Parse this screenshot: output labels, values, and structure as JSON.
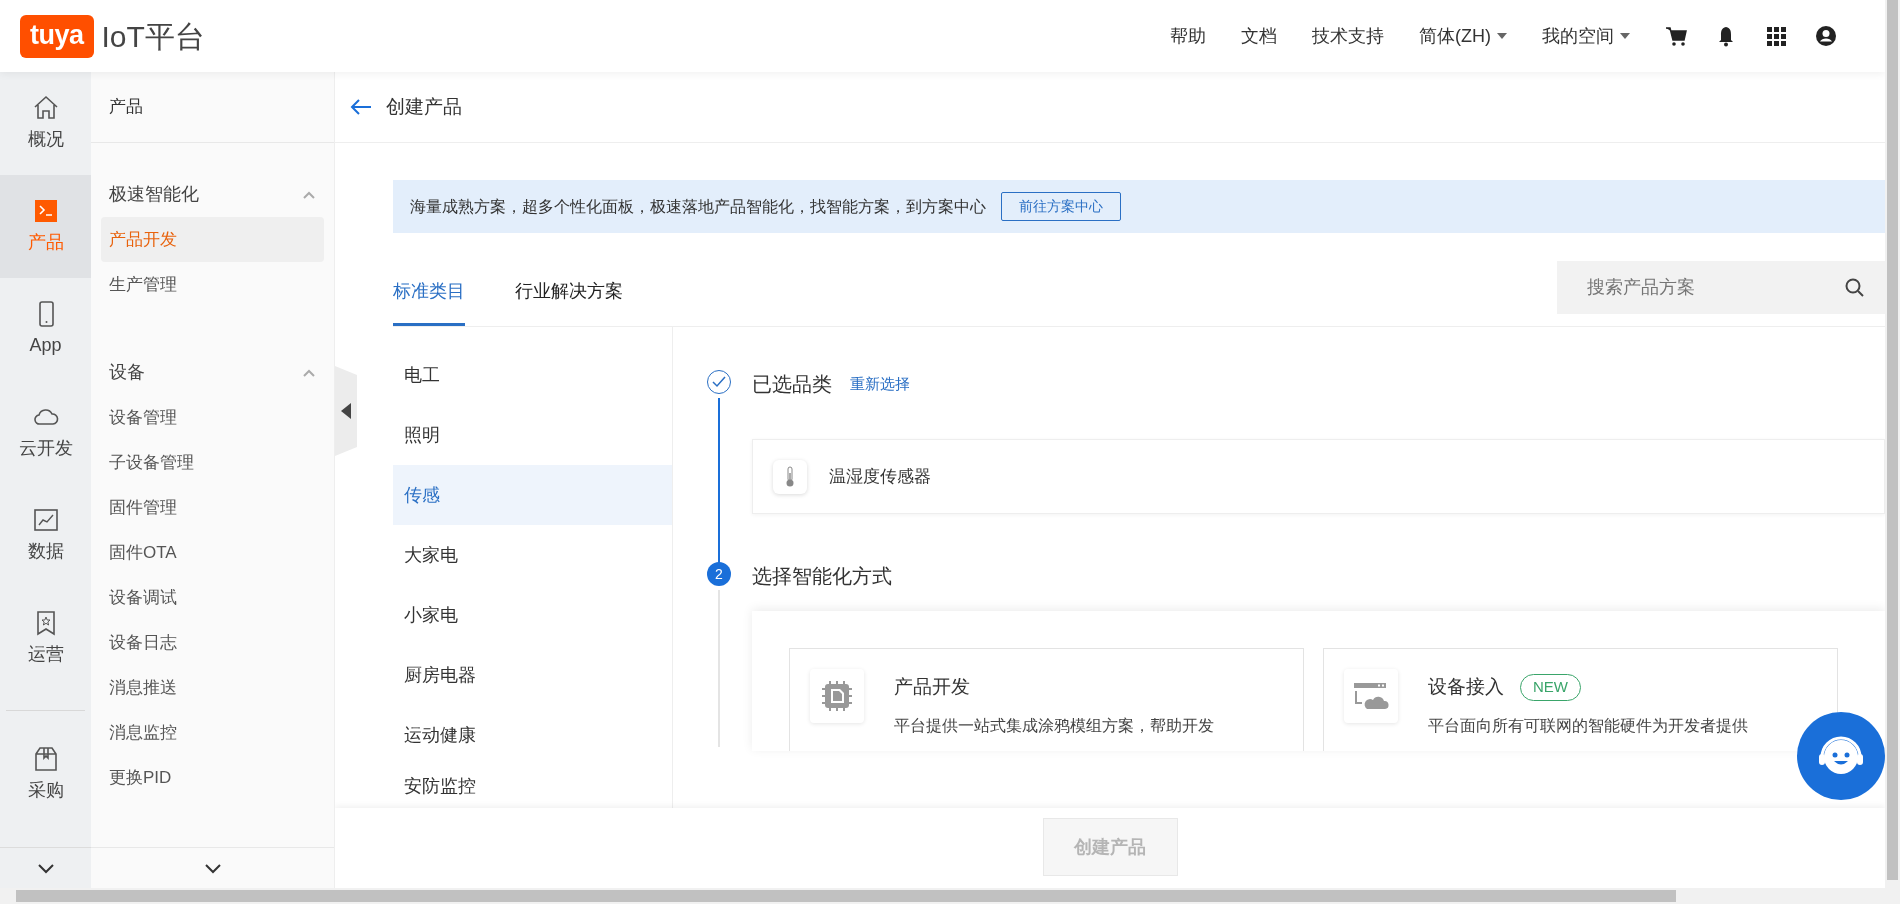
{
  "logo": {
    "brand": "tuya",
    "title": "IoT平台"
  },
  "top_nav": [
    {
      "label": "帮助",
      "kind": "link"
    },
    {
      "label": "文档",
      "kind": "link"
    },
    {
      "label": "技术支持",
      "kind": "link"
    },
    {
      "label": "简体(ZH)",
      "kind": "dropdown"
    },
    {
      "label": "我的空间",
      "kind": "dropdown"
    }
  ],
  "rail": {
    "items": [
      {
        "label": "概况",
        "selected": false
      },
      {
        "label": "产品",
        "selected": true
      },
      {
        "label": "App",
        "selected": false
      },
      {
        "label": "云开发",
        "selected": false
      },
      {
        "label": "数据",
        "selected": false
      },
      {
        "label": "运营",
        "selected": false
      }
    ],
    "more_items": [
      {
        "label": "采购",
        "selected": false
      }
    ]
  },
  "subnav": {
    "title": "产品",
    "groups": [
      {
        "label": "极速智能化",
        "expanded": true,
        "items": [
          {
            "label": "产品开发",
            "selected": true
          },
          {
            "label": "生产管理",
            "selected": false
          }
        ]
      },
      {
        "label": "设备",
        "expanded": true,
        "items": [
          {
            "label": "设备管理",
            "selected": false
          },
          {
            "label": "子设备管理",
            "selected": false
          },
          {
            "label": "固件管理",
            "selected": false
          },
          {
            "label": "固件OTA",
            "selected": false
          },
          {
            "label": "设备调试",
            "selected": false
          },
          {
            "label": "设备日志",
            "selected": false
          },
          {
            "label": "消息推送",
            "selected": false
          },
          {
            "label": "消息监控",
            "selected": false
          },
          {
            "label": "更换PID",
            "selected": false
          }
        ]
      }
    ]
  },
  "page": {
    "title": "创建产品"
  },
  "banner": {
    "text": "海量成熟方案，超多个性化面板，极速落地产品智能化，找智能方案，到方案中心",
    "button": "前往方案中心"
  },
  "tabs": [
    {
      "label": "标准类目",
      "selected": true
    },
    {
      "label": "行业解决方案",
      "selected": false
    }
  ],
  "search": {
    "placeholder": "搜索产品方案"
  },
  "categories": [
    {
      "label": "电工",
      "selected": false
    },
    {
      "label": "照明",
      "selected": false
    },
    {
      "label": "传感",
      "selected": true
    },
    {
      "label": "大家电",
      "selected": false
    },
    {
      "label": "小家电",
      "selected": false
    },
    {
      "label": "厨房电器",
      "selected": false
    },
    {
      "label": "运动健康",
      "selected": false
    },
    {
      "label": "安防监控",
      "selected": false
    }
  ],
  "steps": [
    {
      "title": "已选品类",
      "done": true,
      "action": "重新选择"
    },
    {
      "title": "选择智能化方式",
      "done": false,
      "number": "2"
    }
  ],
  "selected_category": {
    "name": "温湿度传感器"
  },
  "methods": [
    {
      "title": "产品开发",
      "description": "平台提供一站式集成涂鸦模组方案，帮助开发"
    },
    {
      "title": "设备接入",
      "badge": "NEW",
      "description": "平台面向所有可联网的智能硬件为开发者提供"
    }
  ],
  "footer": {
    "button": "创建产品",
    "disabled": true
  }
}
